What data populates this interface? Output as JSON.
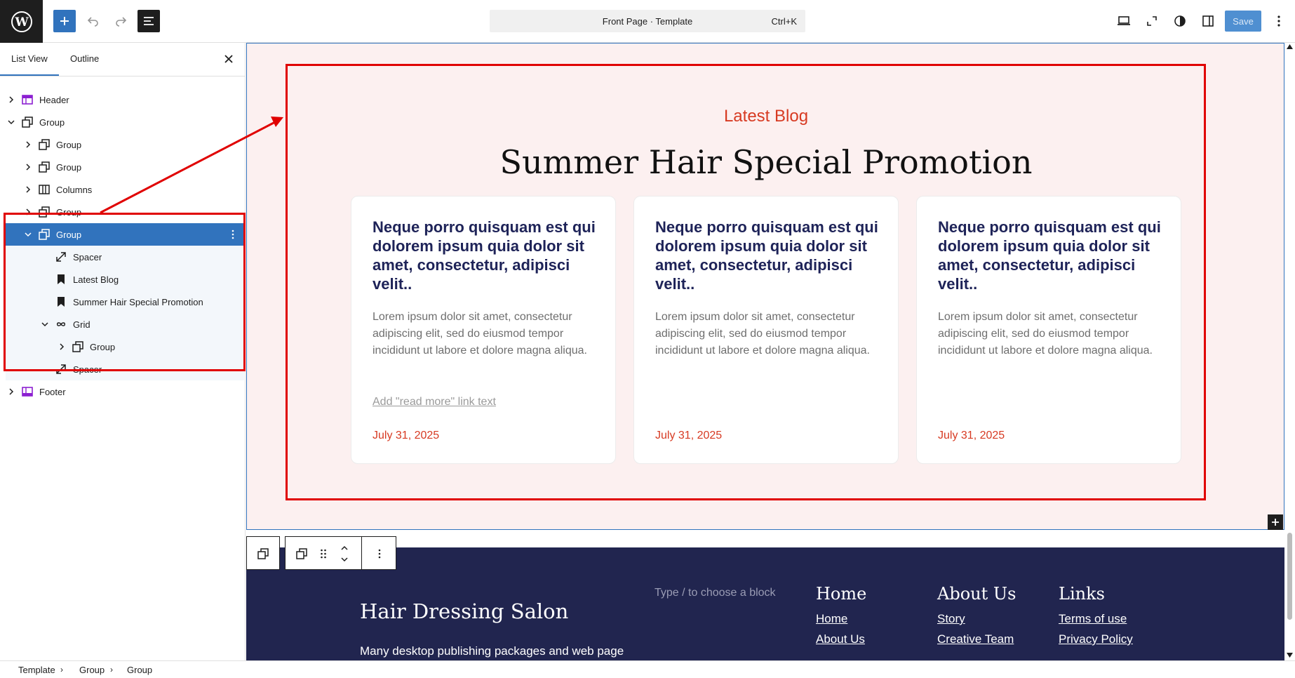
{
  "topbar": {
    "command_title": "Front Page · Template",
    "command_shortcut": "Ctrl+K",
    "save_label": "Save"
  },
  "panel": {
    "tab_list": "List View",
    "tab_outline": "Outline"
  },
  "tree": [
    {
      "label": "Header",
      "icon": "header-template-icon"
    },
    {
      "label": "Group",
      "icon": "group-icon"
    },
    {
      "label": "Group",
      "icon": "group-icon"
    },
    {
      "label": "Group",
      "icon": "group-icon"
    },
    {
      "label": "Columns",
      "icon": "columns-icon"
    },
    {
      "label": "Group",
      "icon": "group-icon"
    },
    {
      "label": "Group",
      "icon": "group-icon"
    },
    {
      "label": "Spacer",
      "icon": "spacer-icon"
    },
    {
      "label": "Latest Blog",
      "icon": "bookmark-icon"
    },
    {
      "label": "Summer Hair Special Promotion",
      "icon": "bookmark-icon"
    },
    {
      "label": "Grid",
      "icon": "query-loop-icon"
    },
    {
      "label": "Group",
      "icon": "group-icon"
    },
    {
      "label": "Spacer",
      "icon": "spacer-icon"
    },
    {
      "label": "Footer",
      "icon": "footer-template-icon"
    }
  ],
  "section": {
    "eyebrow": "Latest Blog",
    "title": "Summer Hair Special Promotion"
  },
  "cards": [
    {
      "heading": "Neque porro quisquam est qui dolorem ipsum quia dolor sit amet, consectetur, adipisci velit..",
      "excerpt": "Lorem ipsum dolor sit amet, consectetur adipiscing elit, sed do eiusmod tempor incididunt ut labore et dolore magna aliqua.",
      "read_more": "Add \"read more\" link text",
      "date": "July 31, 2025"
    },
    {
      "heading": "Neque porro quisquam est qui dolorem ipsum quia dolor sit amet, consectetur, adipisci velit..",
      "excerpt": "Lorem ipsum dolor sit amet, consectetur adipiscing elit, sed do eiusmod tempor incididunt ut labore et dolore magna aliqua.",
      "date": "July 31, 2025"
    },
    {
      "heading": "Neque porro quisquam est qui dolorem ipsum quia dolor sit amet, consectetur, adipisci velit..",
      "excerpt": "Lorem ipsum dolor sit amet, consectetur adipiscing elit, sed do eiusmod tempor incididunt ut labore et dolore magna aliqua.",
      "date": "July 31, 2025"
    }
  ],
  "footer": {
    "site_title": "Hair Dressing Salon",
    "description": "Many desktop publishing packages and web page",
    "placeholder": "Type / to choose a block",
    "col1": {
      "title": "Home",
      "links": [
        "Home",
        "About Us"
      ]
    },
    "col2": {
      "title": "About Us",
      "links": [
        "Story",
        "Creative Team"
      ]
    },
    "col3": {
      "title": "Links",
      "links": [
        "Terms of use",
        "Privacy Policy"
      ]
    }
  },
  "breadcrumbs": [
    "Template",
    "Group",
    "Group"
  ],
  "colors": {
    "accent": "#3173bd",
    "annotation": "#e00000",
    "section_bg": "#fcf0f0",
    "heading_navy": "#1e2358",
    "date_red": "#d73a22",
    "footer_bg": "#21254f"
  }
}
